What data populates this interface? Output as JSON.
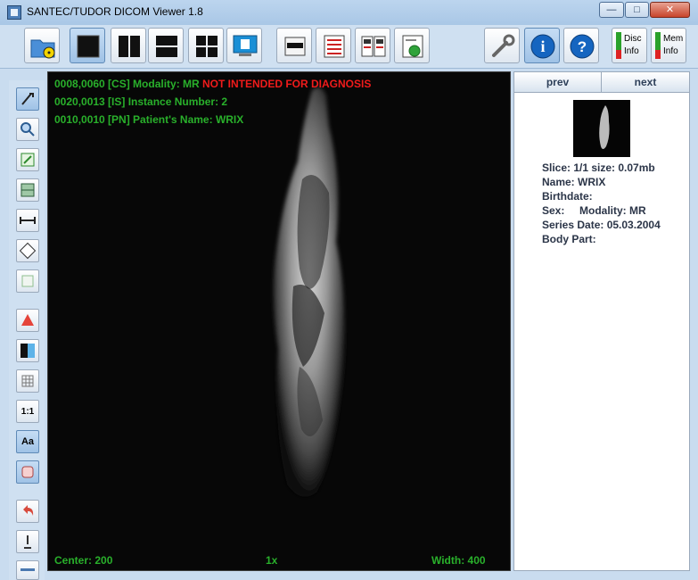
{
  "window": {
    "title": "SANTEC/TUDOR DICOM Viewer 1.8",
    "minimize": "—",
    "maximize": "□",
    "close": "✕"
  },
  "toolbar": {
    "buttons": [
      {
        "name": "open-folder-button",
        "icon": "folder-radiation-icon"
      },
      {
        "name": "layout-single-button",
        "icon": "single-view-icon"
      },
      {
        "name": "layout-two-vertical-button",
        "icon": "two-vertical-icon"
      },
      {
        "name": "layout-two-horizontal-button",
        "icon": "two-horizontal-icon"
      },
      {
        "name": "layout-four-button",
        "icon": "four-grid-icon"
      },
      {
        "name": "monitor-button",
        "icon": "monitor-icon"
      },
      {
        "name": "anonymize-button",
        "icon": "mask-icon"
      },
      {
        "name": "dicom-tags-button",
        "icon": "list-icon"
      },
      {
        "name": "compare-button",
        "icon": "compare-icon"
      },
      {
        "name": "export-button",
        "icon": "export-icon"
      },
      {
        "name": "settings-button",
        "icon": "wrench-icon"
      },
      {
        "name": "about-button",
        "icon": "info-icon"
      },
      {
        "name": "help-button",
        "icon": "help-icon"
      }
    ],
    "disc_label_1": "Disc",
    "disc_label_2": "Info",
    "mem_label_1": "Mem",
    "mem_label_2": "Info"
  },
  "sidebar": {
    "tools": [
      "pan-tool-icon",
      "zoom-tool-icon",
      "fit-tool-icon",
      "window-level-icon",
      "measure-tool-icon",
      "rotate-tool-icon",
      "blank-tool-icon",
      "arrow-up-icon",
      "invert-icon",
      "grid-icon",
      "one-to-one-icon",
      "text-tool-icon",
      "annotation-icon",
      "undo-icon",
      "pen-icon",
      "more-icon"
    ],
    "one_to_one_label": "1:1",
    "text_tool_label": "Aa"
  },
  "viewer": {
    "line1": "0008,0060 [CS] Modality: MR",
    "warning": "NOT INTENDED FOR DIAGNOSIS",
    "line2": "0020,0013 [IS] Instance Number: 2",
    "line3": "0010,0010 [PN] Patient's Name: WRIX",
    "center": "Center: 200",
    "zoom": "1x",
    "width": "Width: 400"
  },
  "panel": {
    "prev": "prev",
    "next": "next",
    "slice": "Slice: 1/1 size: 0.07mb",
    "name": "Name: WRIX",
    "birthdate": "Birthdate:",
    "sex_modality": "Sex:     Modality: MR",
    "series_date": "Series Date: 05.03.2004",
    "body_part": "Body Part:"
  }
}
